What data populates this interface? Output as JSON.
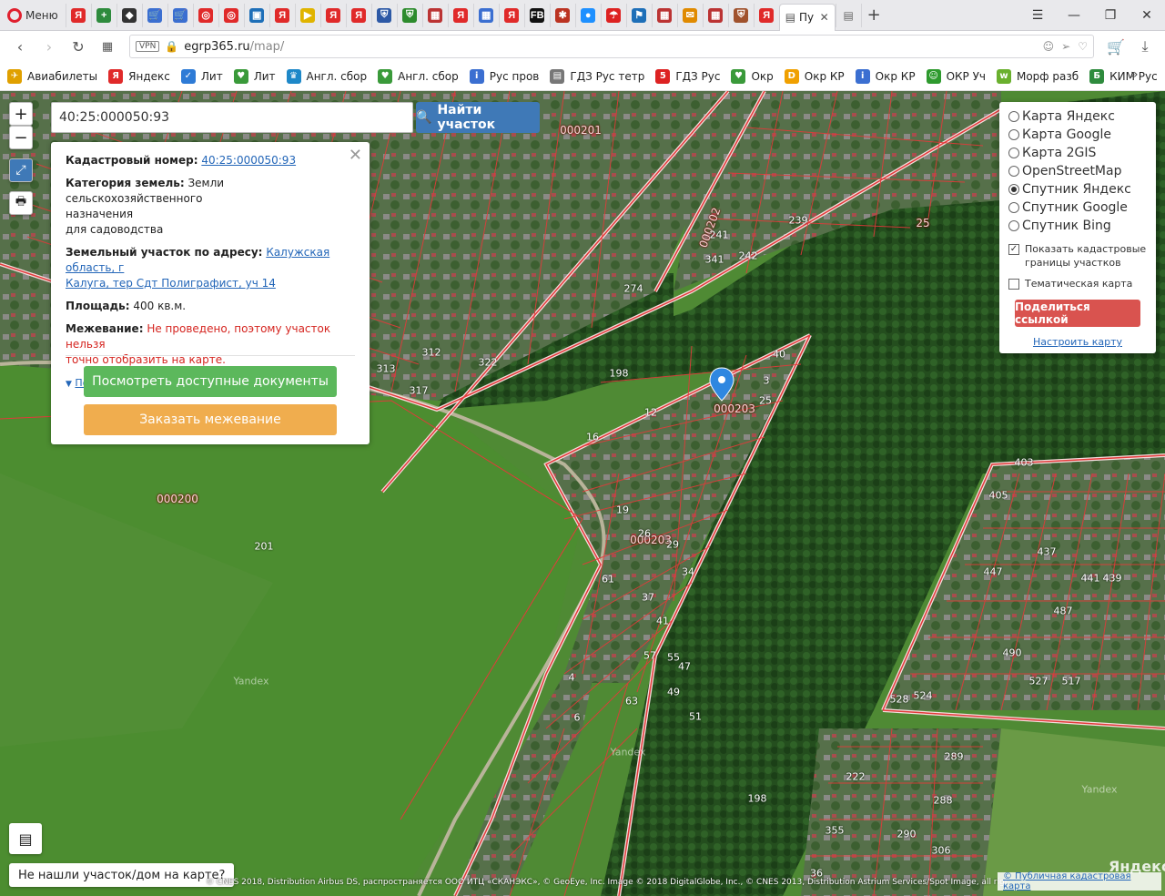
{
  "browser": {
    "menu_label": "Меню",
    "active_tab_title": "Пу",
    "url_host": "egrp365.ru",
    "url_path": "/map/",
    "vpn_badge": "VPN",
    "tab_favicons": [
      {
        "name": "yandex",
        "glyph": "Я",
        "color": "#e02a2a"
      },
      {
        "name": "plus",
        "glyph": "+",
        "color": "#2e8b3d"
      },
      {
        "name": "shield",
        "glyph": "◆",
        "color": "#333333"
      },
      {
        "name": "cart",
        "glyph": "🛒",
        "color": "#3b6fd1"
      },
      {
        "name": "cart",
        "glyph": "🛒",
        "color": "#3b6fd1"
      },
      {
        "name": "opera",
        "glyph": "◎",
        "color": "#e02a2a"
      },
      {
        "name": "opera",
        "glyph": "◎",
        "color": "#e02a2a"
      },
      {
        "name": "tv",
        "glyph": "▣",
        "color": "#1e6fb8"
      },
      {
        "name": "yandex",
        "glyph": "Я",
        "color": "#e02a2a"
      },
      {
        "name": "play",
        "glyph": "▶",
        "color": "#e0b400"
      },
      {
        "name": "yandex",
        "glyph": "Я",
        "color": "#e02a2a"
      },
      {
        "name": "yandex",
        "glyph": "Я",
        "color": "#e02a2a"
      },
      {
        "name": "crest",
        "glyph": "⛨",
        "color": "#2d59a6"
      },
      {
        "name": "crest",
        "glyph": "⛨",
        "color": "#2d8b2d"
      },
      {
        "name": "grid",
        "glyph": "▦",
        "color": "#b33"
      },
      {
        "name": "yandex",
        "glyph": "Я",
        "color": "#e02a2a"
      },
      {
        "name": "window",
        "glyph": "▦",
        "color": "#3b6fd1"
      },
      {
        "name": "yandex",
        "glyph": "Я",
        "color": "#e02a2a"
      },
      {
        "name": "fb",
        "glyph": "FB",
        "color": "#111111"
      },
      {
        "name": "bug",
        "glyph": "✱",
        "color": "#b32"
      },
      {
        "name": "drop",
        "glyph": "●",
        "color": "#1e90ff"
      },
      {
        "name": "umbrella",
        "glyph": "☂",
        "color": "#d22"
      },
      {
        "name": "flag",
        "glyph": "⚑",
        "color": "#1e6fb8"
      },
      {
        "name": "grid",
        "glyph": "▦",
        "color": "#b33"
      },
      {
        "name": "mail",
        "glyph": "✉",
        "color": "#e08a00"
      },
      {
        "name": "grid",
        "glyph": "▦",
        "color": "#b33"
      },
      {
        "name": "crest",
        "glyph": "⛨",
        "color": "#a0522d"
      },
      {
        "name": "yandex",
        "glyph": "Я",
        "color": "#e02a2a"
      }
    ]
  },
  "bookmarks": [
    {
      "label": "Авиабилеты",
      "icon": "plane-icon",
      "glyph": "✈",
      "color": "#e0a000"
    },
    {
      "label": "Яндекс",
      "icon": "yandex-icon",
      "glyph": "Я",
      "color": "#e02a2a"
    },
    {
      "label": "Лит",
      "icon": "check-icon",
      "glyph": "✓",
      "color": "#2e7bd6"
    },
    {
      "label": "Лит",
      "icon": "heart-icon",
      "glyph": "♥",
      "color": "#3a9a3a"
    },
    {
      "label": "Англ. сбор",
      "icon": "crown-icon",
      "glyph": "♛",
      "color": "#1e88c8"
    },
    {
      "label": "Англ. сбор",
      "icon": "heart-icon",
      "glyph": "♥",
      "color": "#3a9a3a"
    },
    {
      "label": "Рус пров",
      "icon": "info-icon",
      "glyph": "i",
      "color": "#3b6fd1"
    },
    {
      "label": "ГДЗ Рус тетр",
      "icon": "doc-icon",
      "glyph": "▤",
      "color": "#777777"
    },
    {
      "label": "ГДЗ Рус",
      "icon": "five-icon",
      "glyph": "5",
      "color": "#d22"
    },
    {
      "label": "Окр",
      "icon": "heart-icon",
      "glyph": "♥",
      "color": "#3a9a3a"
    },
    {
      "label": "Окр КР",
      "icon": "d-icon",
      "glyph": "D",
      "color": "#f0a000"
    },
    {
      "label": "Окр КР",
      "icon": "info-icon",
      "glyph": "i",
      "color": "#3b6fd1"
    },
    {
      "label": "ОКР Уч",
      "icon": "smile-icon",
      "glyph": "☺",
      "color": "#2e9a2e"
    },
    {
      "label": "Морф разб",
      "icon": "w-icon",
      "glyph": "w",
      "color": "#6ab02e"
    },
    {
      "label": "КИМ Рус",
      "icon": "b-icon",
      "glyph": "Б",
      "color": "#2e8b3d"
    }
  ],
  "map": {
    "search_value": "40:25:000050:93",
    "search_button": "Найти участок",
    "info": {
      "cad_label": "Кадастровый номер:",
      "cad_value": "40:25:000050:93",
      "category_label": "Категория земель:",
      "category_value_1": "Земли сельскохозяйственного",
      "category_value_2": "назначения",
      "category_value_3": "для садоводства",
      "address_label": "Земельный участок по адресу:",
      "address_value_1": "Калужская область, г",
      "address_value_2": "Калуга, тер Сдт Полиграфист, уч 14",
      "area_label": "Площадь:",
      "area_value": "400 кв.м.",
      "survey_label": "Межевание:",
      "survey_value_1": "Не проведено, поэтому участок нельзя",
      "survey_value_2": "точно отобразить на карте.",
      "details_link": "Подробно",
      "docs_button": "Посмотреть доступные документы",
      "order_button": "Заказать межевание"
    },
    "layers": {
      "options": [
        "Карта Яндекс",
        "Карта Google",
        "Карта 2GIS",
        "OpenStreetMap",
        "Спутник Яндекс",
        "Спутник Google",
        "Спутник Bing"
      ],
      "selected_index": 4,
      "cadastral_label_1": "Показать кадастровые",
      "cadastral_label_2": "границы участков",
      "cadastral_checked": true,
      "thematic_label": "Тематическая карта",
      "thematic_checked": false,
      "share_button": "Поделиться ссылкой",
      "config_link": "Настроить карту"
    },
    "not_found_button": "Не нашли участок/дом на карте?",
    "copyright": "© CNES 2018, Distribution Airbus DS, распространяется ООО ИТЦ «СКАНЭКС», © GeoEye, Inc. Image © 2018 DigitalGlobe, Inc., © CNES 2013, Distribution Astrium Services/Spot Image, all rights reserved",
    "pkk_link": "© Публичная кадастровая карта",
    "yandex_logo": "Яндекс",
    "cadastral_quarters": [
      "000201",
      "000202",
      "000203",
      "000203",
      "000200",
      "25"
    ],
    "parcel_numbers": [
      "198",
      "201",
      "198",
      "222",
      "289",
      "288",
      "290",
      "306",
      "36",
      "355",
      "239",
      "241",
      "242",
      "341",
      "274",
      "312",
      "317",
      "313",
      "322",
      "40",
      "3",
      "25",
      "12",
      "16",
      "19",
      "26",
      "29",
      "34",
      "37",
      "41",
      "47",
      "49",
      "51",
      "55",
      "57",
      "61",
      "63",
      "4",
      "6",
      "403",
      "405",
      "437",
      "441",
      "439",
      "447",
      "487",
      "490",
      "517",
      "527",
      "528",
      "524"
    ],
    "yandex_watermarks": [
      "Yandex",
      "Yandex",
      "Yandex"
    ],
    "colors": {
      "accent_blue": "#3f79b7",
      "green_button": "#5cb85c",
      "orange_button": "#f0ad4e",
      "red_button": "#d9534f",
      "parcel_line": "#e23a3a",
      "boundary_line": "#f4dede"
    }
  }
}
